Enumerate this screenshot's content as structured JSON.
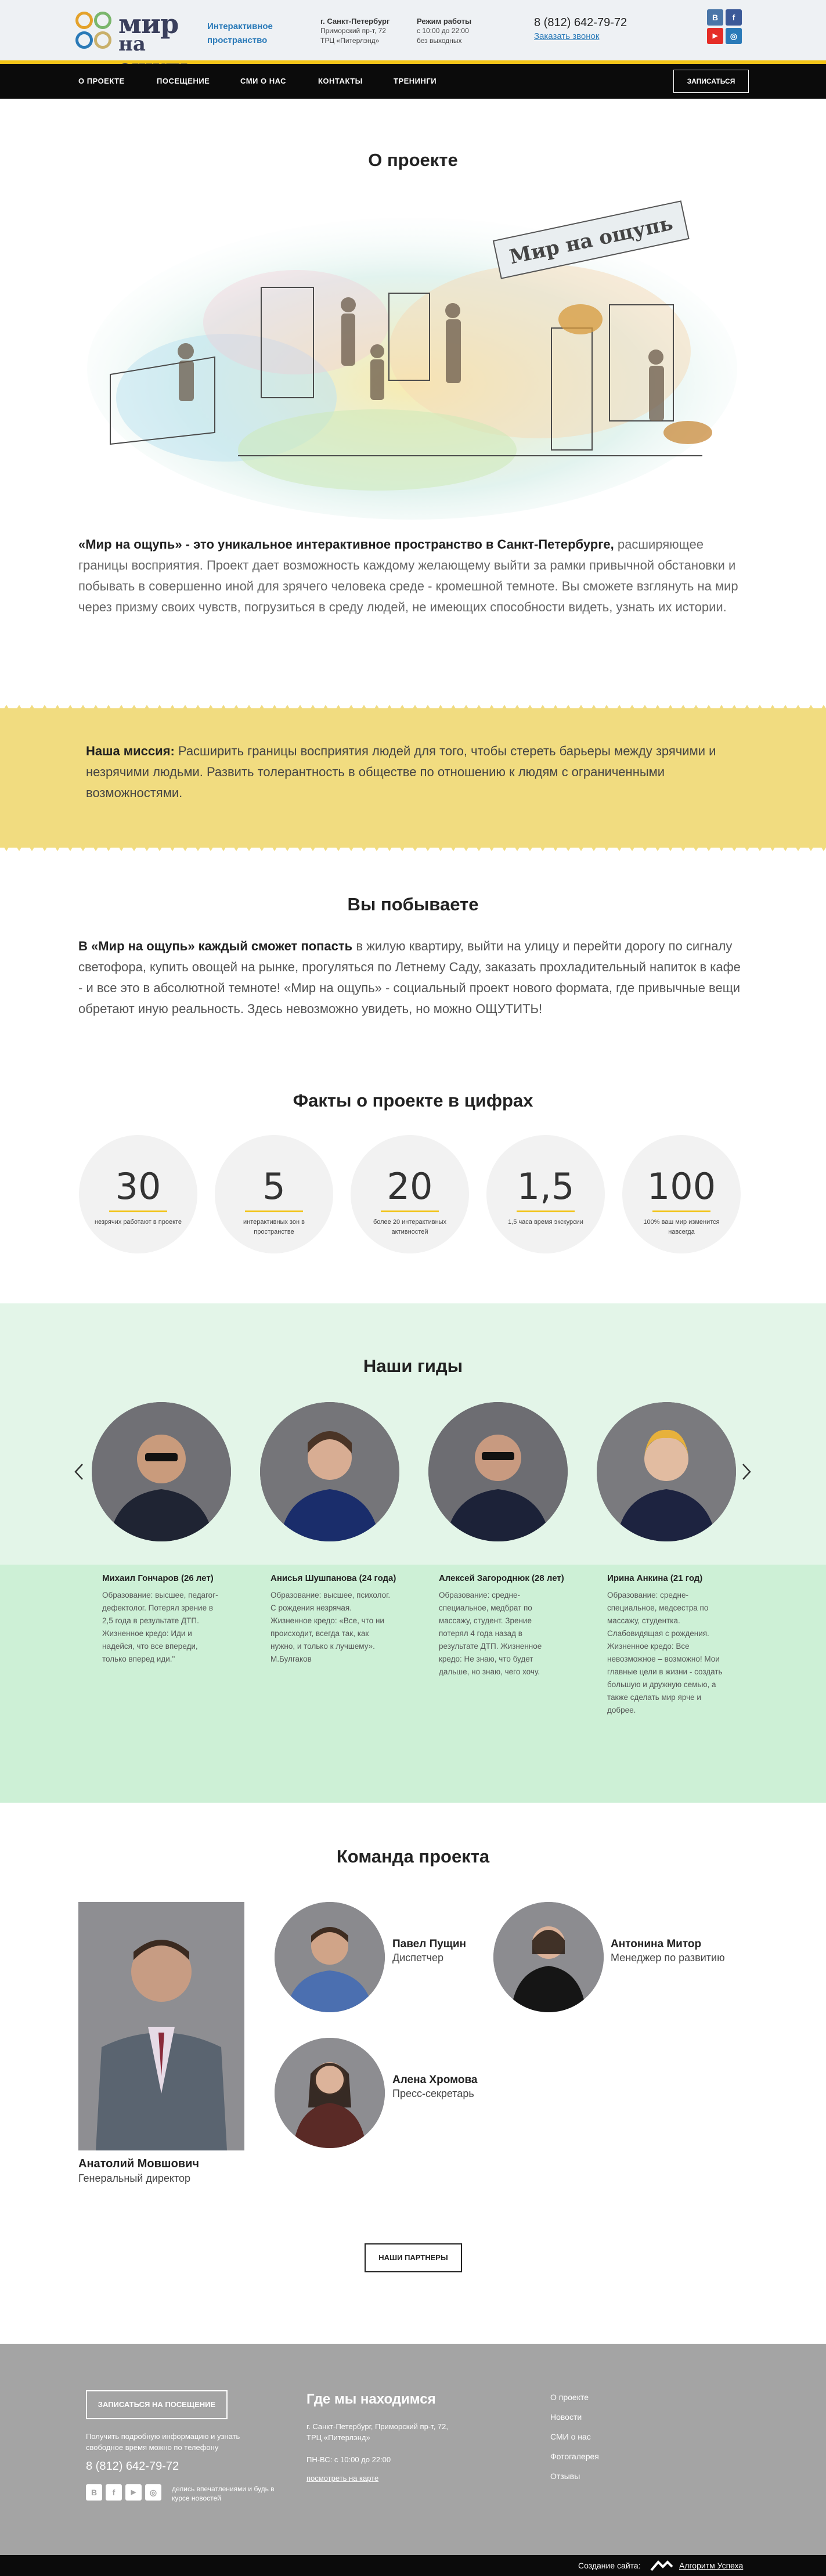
{
  "header": {
    "logo_line1": "мир",
    "logo_line2": "на ощупь",
    "tagline": "Интерактивное пространство",
    "address": {
      "title": "г. Санкт-Петербург",
      "line1": "Приморский пр-т, 72",
      "line2": "ТРЦ «Питерлэнд»"
    },
    "hours": {
      "title": "Режим работы",
      "line1": "с 10:00 до 22:00",
      "line2": "без выходных"
    },
    "phone": "8 (812) 642-79-72",
    "callback": "Заказать звонок",
    "social": [
      "В",
      "f",
      "▶",
      "◎"
    ]
  },
  "nav": {
    "items": [
      "О ПРОЕКТЕ",
      "ПОСЕЩЕНИЕ",
      "СМИ О НАС",
      "КОНТАКТЫ",
      "ТРЕНИНГИ"
    ],
    "cta": "ЗАПИСАТЬСЯ"
  },
  "about": {
    "title": "О проекте",
    "sign_text": "Мир на ощупь",
    "lead_bold": "«Мир на ощупь» - это уникальное интерактивное пространство в Санкт-Петербурге,",
    "lead_rest": " расширяющее границы восприятия. Проект дает возможность каждому желающему выйти за рамки привычной обстановки и побывать в совершенно иной для зрячего человека среде - кромешной темноте. Вы сможете взглянуть на мир через призму своих чувств, погрузиться в среду людей, не имеющих способности видеть, узнать их истории."
  },
  "mission": {
    "bold": "Наша миссия:",
    "text": " Расширить границы восприятия людей для того, чтобы стереть барьеры между зрячими и незрячими людьми. Развить толерантность в обществе по отношению к людям с ограниченными возможностями."
  },
  "visit": {
    "title": "Вы побываете",
    "lead_bold": "В «Мир на ощупь» каждый сможет попасть",
    "lead_rest": " в жилую квартиру, выйти на улицу и перейти дорогу по сигналу светофора, купить овощей на рынке, прогуляться по Летнему Саду, заказать прохладительный напиток в кафе - и все это в абсолютной темноте! «Мир на ощупь» - социальный проект нового формата, где привычные вещи обретают иную реальность. Здесь невозможно увидеть, но можно ОЩУТИТЬ!"
  },
  "facts": {
    "title": "Факты о проекте в цифрах",
    "items": [
      {
        "num": "30",
        "cap": "незрячих работают в проекте"
      },
      {
        "num": "5",
        "cap": "интерактивных зон в пространстве"
      },
      {
        "num": "20",
        "cap": "более 20 интерактивных активностей"
      },
      {
        "num": "1,5",
        "cap": "1,5 часа время экскурсии"
      },
      {
        "num": "100",
        "cap": "100% ваш мир изменится навсегда"
      }
    ]
  },
  "guides": {
    "title": "Наши гиды",
    "items": [
      {
        "name": "Михаил Гончаров (26 лет)",
        "desc": "Образование: высшее, педагог-дефектолог. Потерял зрение в 2,5 года в результате ДТП. Жизненное кредо: Иди и надейся, что все впереди, только вперед иди.\""
      },
      {
        "name": "Анисья Шушпанова (24 года)",
        "desc": "Образование: высшее, психолог. С рождения незрячая. Жизненное кредо: «Все, что ни происходит, всегда так, как нужно, и только к лучшему». М.Булгаков"
      },
      {
        "name": "Алексей Загороднюк (28 лет)",
        "desc": "Образование: средне-специальное, медбрат по массажу, студент. Зрение потерял 4 года назад в результате ДТП. Жизненное кредо: Не знаю, что будет дальше, но знаю, чего хочу."
      },
      {
        "name": "Ирина Анкина (21 год)",
        "desc": "Образование: средне-специальное, медсестра по массажу, студентка. Слабовидящая с рождения. Жизненное кредо: Все невозможное – возможно! Мои главные цели в жизни - создать большую и дружную семью, а также сделать мир ярче и добрее."
      }
    ]
  },
  "team": {
    "title": "Команда проекта",
    "lead": {
      "name": "Анатолий Мовшович",
      "role": "Генеральный директор"
    },
    "members": [
      {
        "name": "Павел Пущин",
        "role": "Диспетчер"
      },
      {
        "name": "Антонина Митор",
        "role": "Менеджер по развитию"
      },
      {
        "name": "Алена Хромова",
        "role": "Пресс-секретарь"
      }
    ],
    "partners_button": "НАШИ ПАРТНЕРЫ"
  },
  "footer": {
    "signup_button": "ЗАПИСАТЬСЯ НА ПОСЕЩЕНИЕ",
    "info": "Получить подробную информацию и узнать свободное время можно по телефону",
    "phone": "8 (812) 642-79-72",
    "social_note": "делись впечатлениями и будь в курсе новостей",
    "where_title": "Где мы находимся",
    "address": "г. Санкт-Петербург, Приморский пр-т, 72, ТРЦ «Питерлэнд»",
    "hours": "ПН-ВС: с 10:00 до 22:00",
    "map_link": "посмотреть на карте",
    "menu": [
      "О проекте",
      "Новости",
      "СМИ о нас",
      "Фотогалерея",
      "Отзывы"
    ],
    "made_by": "Создание сайта:",
    "agency": "Алгоритм Успеха"
  },
  "colors": {
    "accent": "#f2c418",
    "link": "#2a7ab8",
    "mission_bg": "#f1dc80",
    "guides_bg": "#e3f5e8",
    "footer_bg": "#a4a4a4"
  }
}
